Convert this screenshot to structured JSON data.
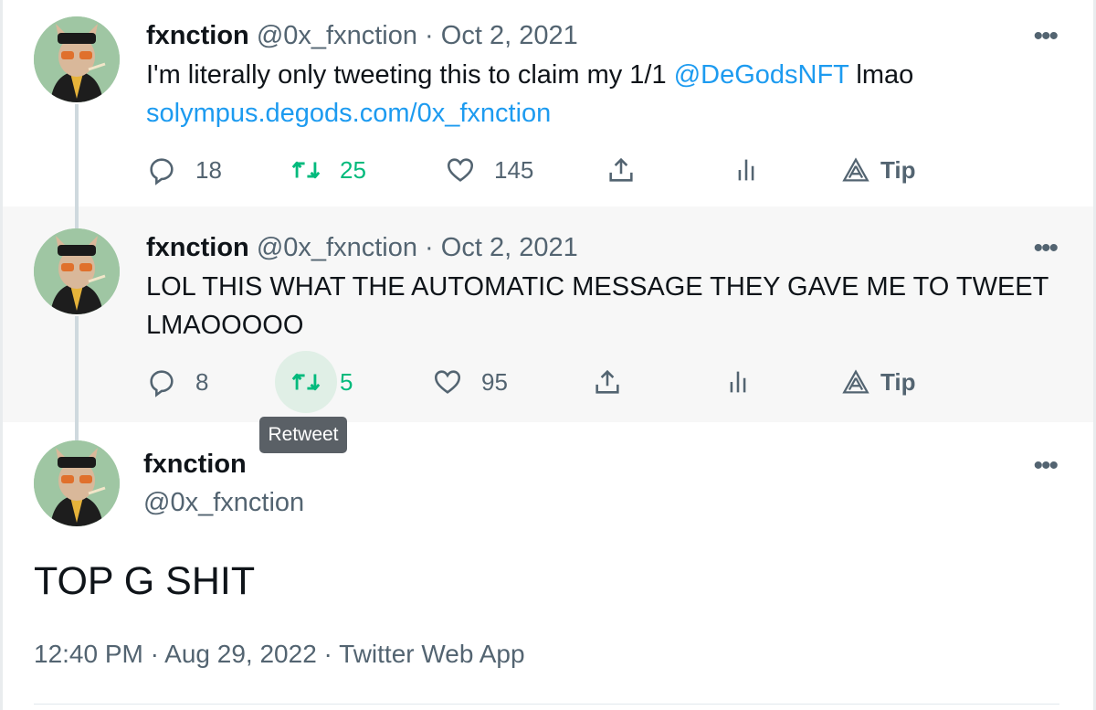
{
  "tweets": [
    {
      "name": "fxnction",
      "handle": "@0x_fxnction",
      "separator": "·",
      "date": "Oct 2, 2021",
      "text_line1_prefix": "I'm literally only tweeting this to claim my 1/1 ",
      "mention": "@DeGodsNFT",
      "text_line1_suffix": " lmao",
      "link": "solympus.degods.com/0x_fxnction",
      "replies": "18",
      "retweets": "25",
      "likes": "145",
      "tip_label": "Tip"
    },
    {
      "name": "fxnction",
      "handle": "@0x_fxnction",
      "separator": "·",
      "date": "Oct 2, 2021",
      "text_line1": "LOL THIS WHAT THE AUTOMATIC MESSAGE THEY GAVE ME TO TWEET",
      "text_line2": "LMAOOOOO",
      "replies": "8",
      "retweets": "5",
      "likes": "95",
      "tip_label": "Tip"
    }
  ],
  "tooltip": "Retweet",
  "main_tweet": {
    "name": "fxnction",
    "handle": "@0x_fxnction",
    "text": "TOP G SHIT",
    "meta": "12:40 PM · Aug 29, 2022 · Twitter Web App"
  },
  "more_label": "•••",
  "colors": {
    "retweet": "#00ba7c",
    "link": "#1d9bf0",
    "secondary": "#536471",
    "highlight_bg": "#f7f7f7"
  },
  "icons": [
    "reply-icon",
    "retweet-icon",
    "like-icon",
    "share-icon",
    "analytics-icon",
    "tip-icon",
    "more-icon"
  ]
}
